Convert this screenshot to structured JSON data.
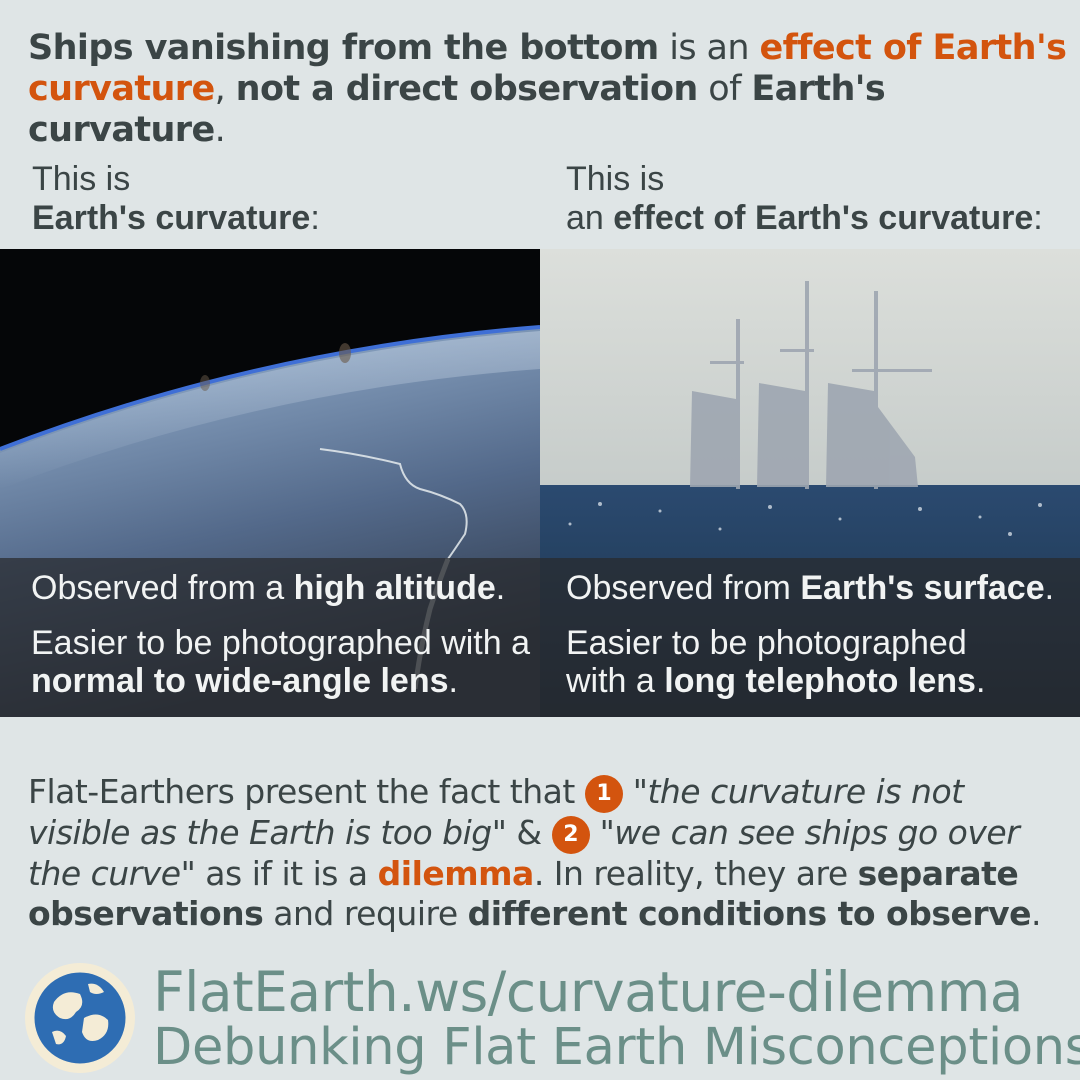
{
  "headline": {
    "part1": "Ships vanishing from the bottom",
    "part2": " is an ",
    "part3": "effect of Earth's curvature",
    "part4": ", ",
    "part5": "not a direct observation",
    "part6": " of ",
    "part7": "Earth's curvature",
    "part8": "."
  },
  "left_column": {
    "label_line1": "This is",
    "label_bold": "Earth's curvature",
    "label_suffix": ":",
    "caption1_pre": "Observed from a ",
    "caption1_bold": "high altitude",
    "caption1_post": ".",
    "caption2_pre": "Easier to be photographed with a ",
    "caption2_bold": "normal to wide-angle lens",
    "caption2_post": "."
  },
  "right_column": {
    "label_line1": "This is",
    "label_pre": "an ",
    "label_bold": "effect of Earth's curvature",
    "label_suffix": ":",
    "caption1_pre": "Observed from ",
    "caption1_bold": "Earth's surface",
    "caption1_post": ".",
    "caption2_line1": "Easier to be photographed",
    "caption2_pre": "with a ",
    "caption2_bold": "long telephoto lens",
    "caption2_post": "."
  },
  "body": {
    "intro": "Flat-Earthers present the fact that ",
    "num1": "1",
    "quote1": "\"the curvature is not visible as the Earth is too big\"",
    "amp": " & ",
    "num2": "2",
    "quote2": "\"we can see ships go over the curve\"",
    "mid": " as if it is a ",
    "dilemma": "dilemma",
    "after_dilemma": ". In reality, they are ",
    "separate": "separate observations",
    "and_require": " and require ",
    "different": "different conditions to observe",
    "end": "."
  },
  "footer": {
    "url": "FlatEarth.ws/curvature-dilemma",
    "tagline": "Debunking Flat Earth Misconceptions"
  },
  "colors": {
    "accent": "#d3540e",
    "text": "#3b4546",
    "background": "#dfe5e6",
    "footer_text": "#6b8f88"
  },
  "icons": {
    "logo": "flat-earth-globe-icon"
  }
}
